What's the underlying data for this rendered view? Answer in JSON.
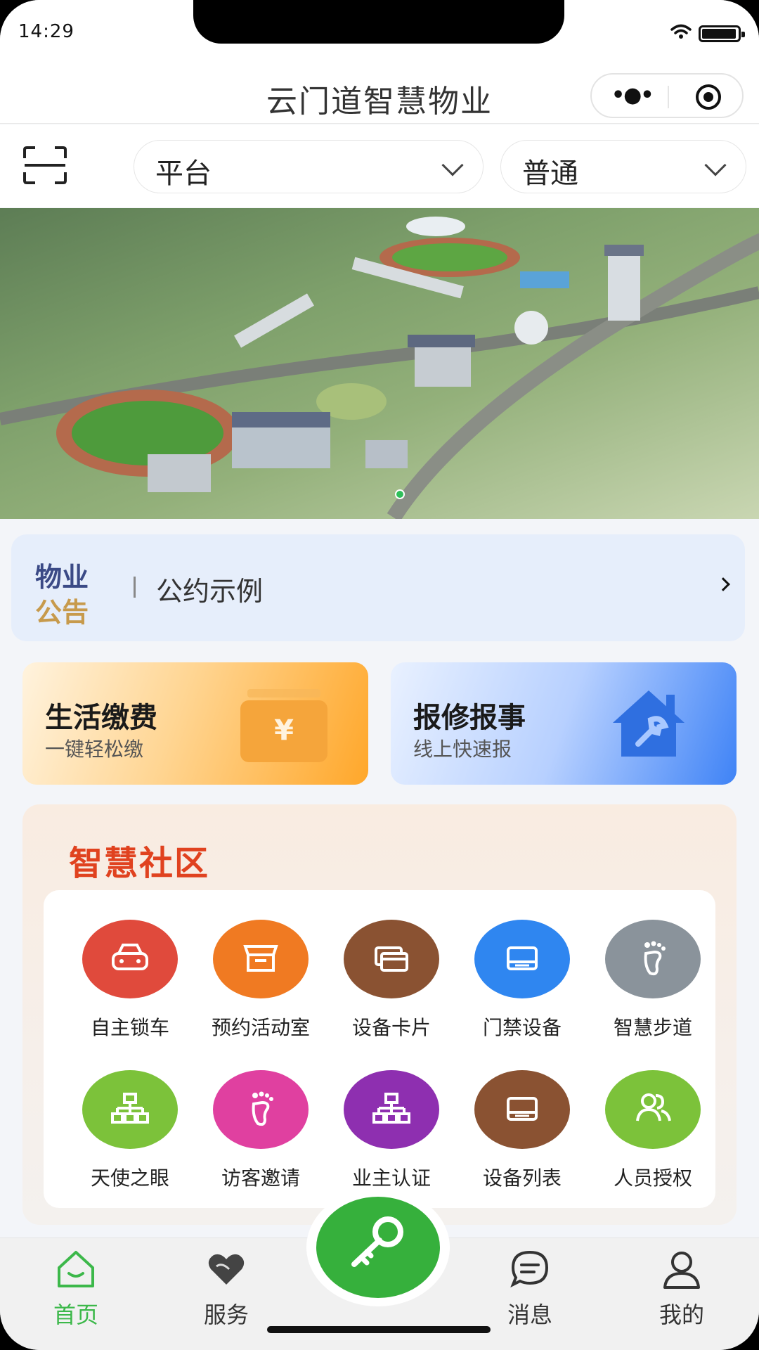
{
  "status_bar": {
    "time": "14:29"
  },
  "nav": {
    "title": "云门道智慧物业"
  },
  "filters": {
    "platform": {
      "selected": "平台"
    },
    "level": {
      "selected": "普通"
    }
  },
  "notice": {
    "tag_line1": "物业",
    "tag_line2": "公告",
    "text": "公约示例"
  },
  "quick_actions": [
    {
      "title": "生活缴费",
      "subtitle": "一键轻松缴",
      "icon": "wallet-yen-icon",
      "color": "#ffa72a"
    },
    {
      "title": "报修报事",
      "subtitle": "线上快速报",
      "icon": "house-wrench-icon",
      "color": "#3f83f6"
    }
  ],
  "community": {
    "title": "智慧社区",
    "items": [
      {
        "label": "自主锁车",
        "icon": "car-icon",
        "color": "#e04a3c"
      },
      {
        "label": "预约活动室",
        "icon": "store-icon",
        "color": "#f07a22"
      },
      {
        "label": "设备卡片",
        "icon": "cards-icon",
        "color": "#8a5232"
      },
      {
        "label": "门禁设备",
        "icon": "device-icon",
        "color": "#2f86f0"
      },
      {
        "label": "智慧步道",
        "icon": "footprint-icon",
        "color": "#8a939b"
      },
      {
        "label": "天使之眼",
        "icon": "network-icon",
        "color": "#7cc23a"
      },
      {
        "label": "访客邀请",
        "icon": "footprint-icon",
        "color": "#e040a0"
      },
      {
        "label": "业主认证",
        "icon": "network-icon",
        "color": "#8e2fb0"
      },
      {
        "label": "设备列表",
        "icon": "device-icon",
        "color": "#8a5232"
      },
      {
        "label": "人员授权",
        "icon": "people-icon",
        "color": "#7cc23a"
      }
    ]
  },
  "tabbar": {
    "items": [
      {
        "label": "首页",
        "icon": "home-icon",
        "active": true
      },
      {
        "label": "服务",
        "icon": "heart-icon",
        "active": false
      },
      {
        "label": "消息",
        "icon": "message-icon",
        "active": false
      },
      {
        "label": "我的",
        "icon": "user-icon",
        "active": false
      }
    ],
    "center_icon": "key-icon",
    "active_color": "#3cb84a"
  }
}
